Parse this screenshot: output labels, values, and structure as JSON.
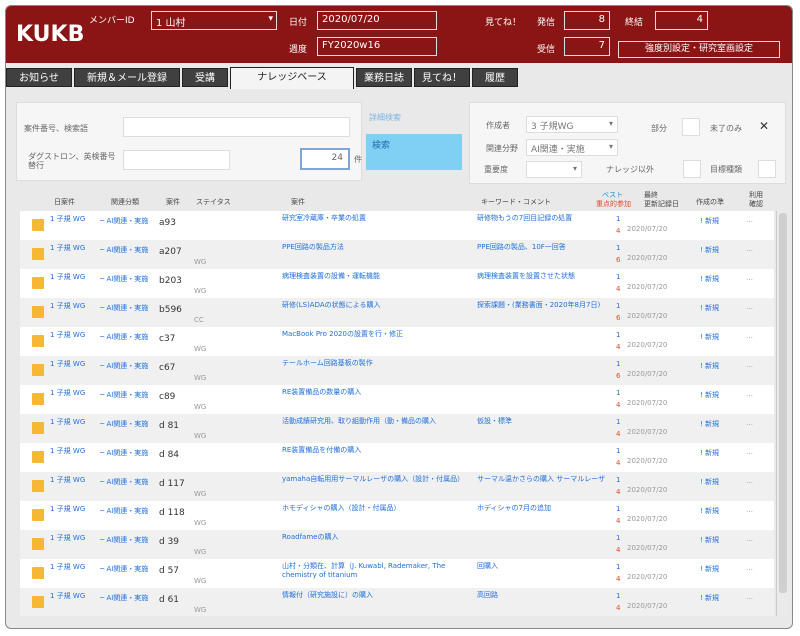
{
  "header": {
    "logo": "KUKB",
    "member_label": "メンバーID",
    "member_value": "1 山村",
    "date_label": "日付",
    "date_value": "2020/07/20",
    "period_label": "週度",
    "period_value": "FY2020w16",
    "mitene_label": "見てね！",
    "sent_label": "発信",
    "sent_value": "8",
    "done_label": "終結",
    "done_value": "4",
    "recv_label": "受信",
    "recv_value": "7",
    "settings_button": "強度別設定・研究室画設定"
  },
  "tabs": [
    "お知らせ",
    "新規＆メール登録",
    "受講",
    "ナレッジベース",
    "業務日誌",
    "見てね！",
    "履歴"
  ],
  "active_tab": "ナレッジベース",
  "filter": {
    "case_label": "案件番号、検索語",
    "case_value": "",
    "keyword_label": "ダグストロン、英検番号 替行",
    "keyword_value": "",
    "number_value": "24",
    "number_unit": "件",
    "advanced_link": "詳細検索",
    "search_button": "検索",
    "author_label": "作成者",
    "author_value": "3 子規WG",
    "area_label": "関連分野",
    "area_value": "AI関連・実施",
    "public_label": "部分",
    "closed_label": "未了のみ",
    "importance_label": "重要度",
    "knowledge_label": "ナレッジ以外",
    "rank_label": "目標種類"
  },
  "table": {
    "headers": {
      "col1": "日案件",
      "col2": "関連分類",
      "col3": "案件",
      "col4": "ステイタス",
      "col5": "案件",
      "col6": "キーワード・コメント",
      "col7_top": "ベスト",
      "col7_bottom": "重点的参加",
      "col8_top": "最終",
      "col8_bottom": "更新記録日",
      "col9": "作成の準",
      "col10_top": "利用",
      "col10_bottom": "確認"
    },
    "rows": [
      {
        "owner": "1 子規 WG",
        "category": "─ AI関連・実施",
        "id": "a93",
        "status": "",
        "title": "研究室冷蔵庫・卒業の処置",
        "keywords": "研修物もうの7回目記録の処置",
        "n1": "1",
        "n2": "4",
        "date": "2020/07/20",
        "act": "! 新規",
        "sfx": "…"
      },
      {
        "owner": "1 子規 WG",
        "category": "─ AI関連・実施",
        "id": "a207",
        "status": "WG",
        "title": "PPE回路の製品方法",
        "keywords": "PPE回路の製品、10F一回答",
        "n1": "1",
        "n2": "6",
        "date": "2020/07/20",
        "act": "! 新規",
        "sfx": "…"
      },
      {
        "owner": "1 子規 WG",
        "category": "─ AI関連・実施",
        "id": "b203",
        "status": "WG",
        "title": "病理検査装置の設備・運転機能",
        "keywords": "病理検査装置を設置させた状態",
        "n1": "1",
        "n2": "4",
        "date": "2020/07/20",
        "act": "! 新規",
        "sfx": "…"
      },
      {
        "owner": "1 子規 WG",
        "category": "─ AI関連・実施",
        "id": "b596",
        "status": "CC",
        "title": "研修(LS)ADAの状態による購入",
        "keywords": "探索課題・(業務書面・2020年8月7日)",
        "n1": "1",
        "n2": "6",
        "date": "2020/07/20",
        "act": "! 新規",
        "sfx": "…"
      },
      {
        "owner": "1 子規 WG",
        "category": "─ AI関連・実施",
        "id": "c37",
        "status": "WG",
        "title": "MacBook Pro 2020の設置を行・修正",
        "keywords": "",
        "n1": "1",
        "n2": "4",
        "date": "2020/07/20",
        "act": "! 新規",
        "sfx": "…"
      },
      {
        "owner": "1 子規 WG",
        "category": "─ AI関連・実施",
        "id": "c67",
        "status": "WG",
        "title": "テールホーム回路基板の製作",
        "keywords": "",
        "n1": "1",
        "n2": "6",
        "date": "2020/07/20",
        "act": "! 新規",
        "sfx": "…"
      },
      {
        "owner": "1 子規 WG",
        "category": "─ AI関連・実施",
        "id": "c89",
        "status": "WG",
        "title": "RE装置備品の数量の購入",
        "keywords": "",
        "n1": "1",
        "n2": "4",
        "date": "2020/07/20",
        "act": "! 新規",
        "sfx": "…"
      },
      {
        "owner": "1 子規 WG",
        "category": "─ AI関連・実施",
        "id": "d 81",
        "status": "WG",
        "title": "活動成績研究用、取り組動作用（動・備品の購入",
        "keywords": "仮設・標準",
        "n1": "1",
        "n2": "4",
        "date": "2020/07/20",
        "act": "! 新規",
        "sfx": "…"
      },
      {
        "owner": "1 子規 WG",
        "category": "─ AI関連・実施",
        "id": "d 84",
        "status": "",
        "title": "RE装置備品を付備の購入",
        "keywords": "",
        "n1": "1",
        "n2": "4",
        "date": "2020/07/20",
        "act": "! 新規",
        "sfx": "…"
      },
      {
        "owner": "1 子規 WG",
        "category": "─ AI関連・実施",
        "id": "d 117",
        "status": "WG",
        "title": "yamaha自転用用サーマルレーザの購入（設計・付属品）",
        "keywords": "サーマル温かさらの購入 サーマルレーザ",
        "n1": "1",
        "n2": "4",
        "date": "2020/07/20",
        "act": "! 新規",
        "sfx": "…"
      },
      {
        "owner": "1 子規 WG",
        "category": "─ AI関連・実施",
        "id": "d 118",
        "status": "WG",
        "title": "ホモディシャの購入（設計・付属品）",
        "keywords": "ホディシャの7月の追加",
        "n1": "1",
        "n2": "4",
        "date": "2020/07/20",
        "act": "! 新規",
        "sfx": "…"
      },
      {
        "owner": "1 子規 WG",
        "category": "─ AI関連・実施",
        "id": "d 39",
        "status": "WG",
        "title": "Roadfameの購入",
        "keywords": "",
        "n1": "1",
        "n2": "4",
        "date": "2020/07/20",
        "act": "! 新規",
        "sfx": "…"
      },
      {
        "owner": "1 子規 WG",
        "category": "─ AI関連・実施",
        "id": "d 57",
        "status": "WG",
        "title": "山村・分類在、計算（J. Kuwabl, Rademaker, The chemistry of titanium",
        "keywords": "回購入",
        "n1": "1",
        "n2": "4",
        "date": "2020/07/20",
        "act": "! 新規",
        "sfx": "…"
      },
      {
        "owner": "1 子規 WG",
        "category": "─ AI関連・実施",
        "id": "d 61",
        "status": "WG",
        "title": "情報付（研究施設に）の購入",
        "keywords": "高回路",
        "n1": "1",
        "n2": "4",
        "date": "2020/07/20",
        "act": "! 新規",
        "sfx": "…"
      }
    ]
  }
}
